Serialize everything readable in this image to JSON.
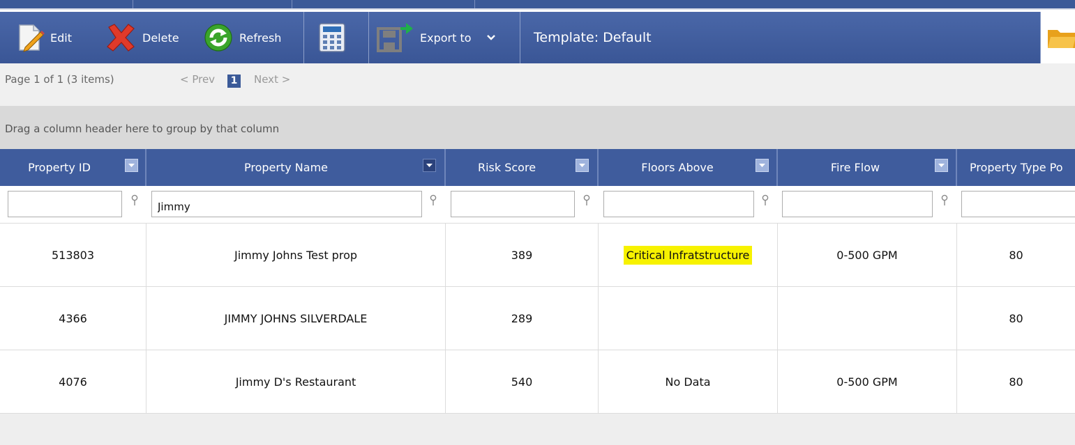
{
  "toolbar": {
    "edit_label": "Edit",
    "delete_label": "Delete",
    "refresh_label": "Refresh",
    "export_label": "Export to",
    "template_label": "Template: Default",
    "icons": [
      "edit-icon",
      "delete-icon",
      "refresh-icon",
      "calculator-icon",
      "export-icon",
      "chevron-down-icon",
      "folder-icon"
    ]
  },
  "pager": {
    "info": "Page 1 of 1 (3 items)",
    "prev": "< Prev",
    "current": "1",
    "next": "Next >"
  },
  "group_panel": {
    "text": "Drag a column header here to group by that column"
  },
  "grid": {
    "columns": [
      {
        "label": "Property ID"
      },
      {
        "label": "Property Name"
      },
      {
        "label": "Risk Score"
      },
      {
        "label": "Floors Above"
      },
      {
        "label": "Fire Flow"
      },
      {
        "label": "Property Type Po"
      }
    ],
    "filters": [
      "",
      "Jimmy",
      "",
      "",
      "",
      ""
    ],
    "rows": [
      {
        "property_id": "513803",
        "property_name": "Jimmy Johns Test prop",
        "risk_score": "389",
        "floors_above": "Critical Infratstructure",
        "fire_flow": "0-500 GPM",
        "property_type": "80"
      },
      {
        "property_id": "4366",
        "property_name": "JIMMY JOHNS SILVERDALE",
        "risk_score": "289",
        "floors_above": "",
        "fire_flow": "",
        "property_type": "80"
      },
      {
        "property_id": "4076",
        "property_name": "Jimmy D's Restaurant",
        "risk_score": "540",
        "floors_above": "No Data",
        "fire_flow": "0-500 GPM",
        "property_type": "80"
      }
    ]
  },
  "colors": {
    "toolbar_bg": "#3f5c9d",
    "highlight": "#f7f200",
    "pager_bg": "#f0f0f0",
    "group_bg": "#d9d9d9"
  }
}
